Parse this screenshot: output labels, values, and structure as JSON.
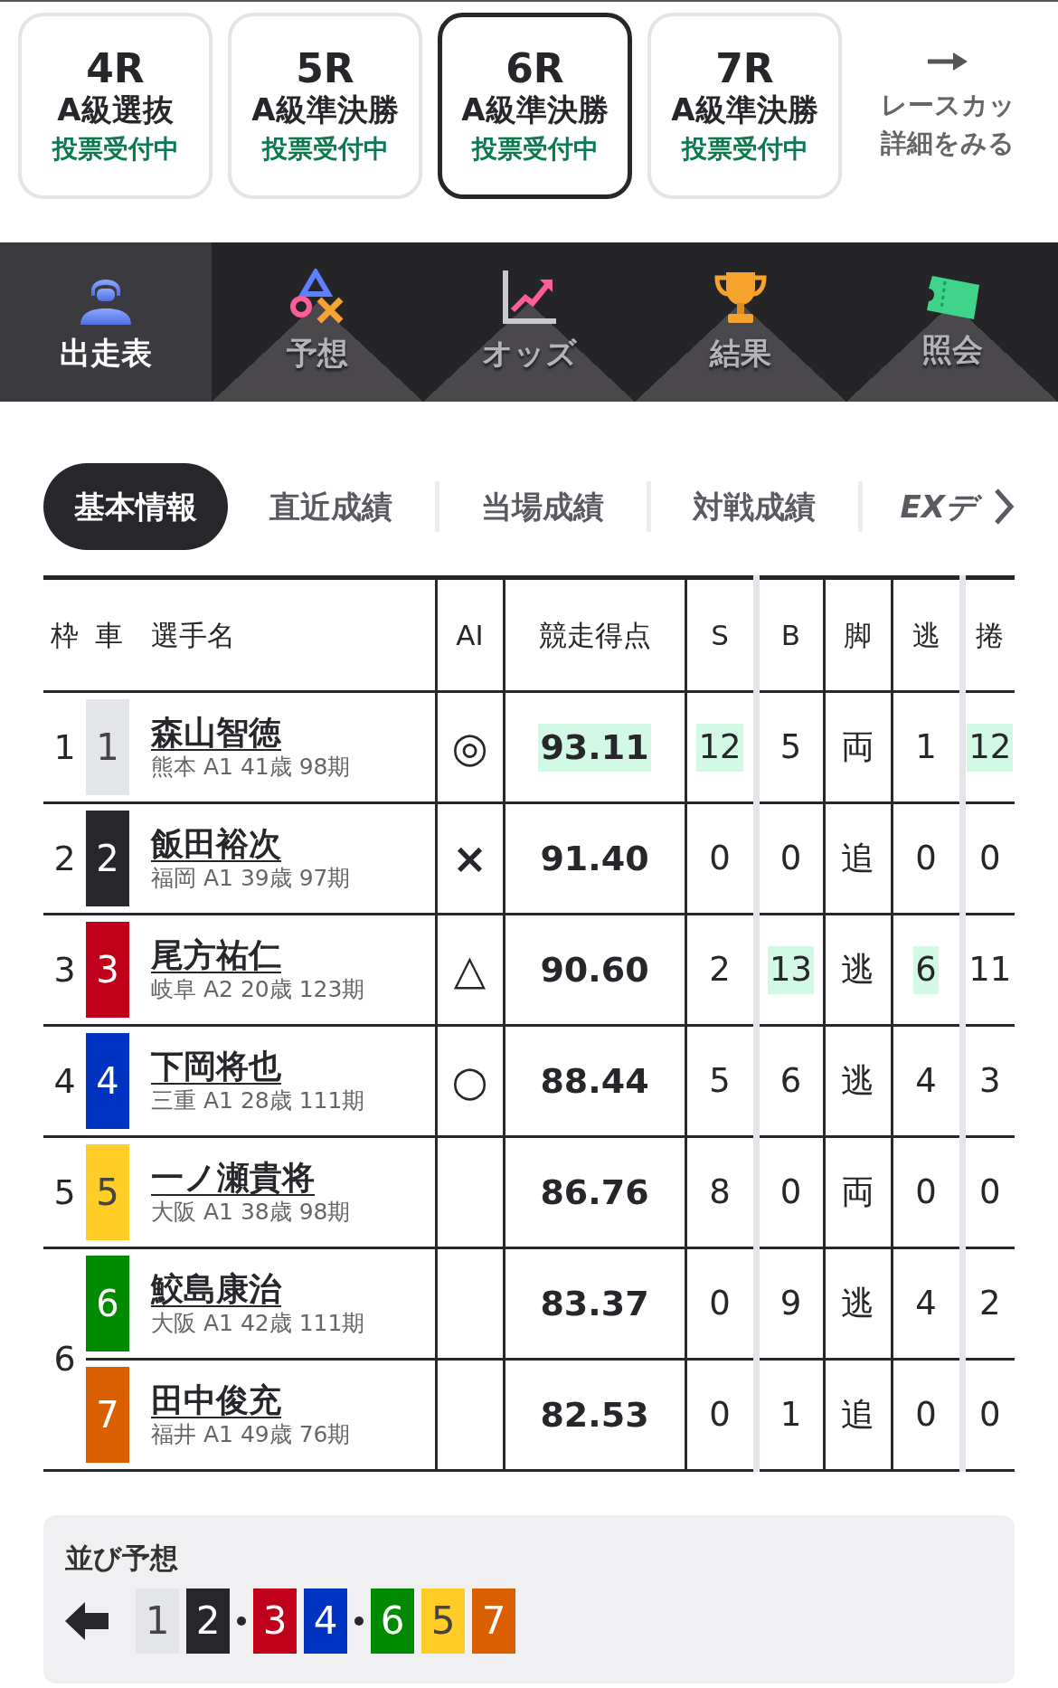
{
  "race_tabs": [
    {
      "race": "4R",
      "grade": "A級選抜",
      "status": "投票受付中",
      "selected": false
    },
    {
      "race": "5R",
      "grade": "A級準決勝",
      "status": "投票受付中",
      "selected": false
    },
    {
      "race": "6R",
      "grade": "A級準決勝",
      "status": "投票受付中",
      "selected": true
    },
    {
      "race": "7R",
      "grade": "A級準決勝",
      "status": "投票受付中",
      "selected": false
    }
  ],
  "cup_link": {
    "line1": "レースカッ",
    "line2": "詳細をみる"
  },
  "main_tabs": [
    {
      "label": "出走表",
      "kind": "rider",
      "selected": true
    },
    {
      "label": "予想",
      "kind": "symbols",
      "selected": false
    },
    {
      "label": "オッズ",
      "kind": "chart",
      "selected": false
    },
    {
      "label": "結果",
      "kind": "trophy",
      "selected": false
    },
    {
      "label": "照会",
      "kind": "ticket",
      "selected": false
    }
  ],
  "sub_tabs": [
    {
      "label": "基本情報",
      "selected": true
    },
    {
      "label": "直近成績",
      "selected": false
    },
    {
      "label": "当場成績",
      "selected": false
    },
    {
      "label": "対戦成績",
      "selected": false
    },
    {
      "label": "EXデ",
      "selected": false
    }
  ],
  "table": {
    "columns": [
      "枠",
      "車",
      "選手名",
      "AI",
      "競走得点",
      "S",
      "B",
      "脚",
      "逃",
      "捲"
    ],
    "frames": [
      {
        "frame": "1",
        "riders": [
          {
            "car": "1",
            "color": "#e4e5e9",
            "name": "森山智徳",
            "profile": "熊本 A1 41歳 98期",
            "ai_mark": "◎",
            "score": {
              "text": "93.11",
              "highlighted": true
            },
            "stats": [
              {
                "text": "12",
                "highlighted": true
              },
              {
                "text": "5",
                "highlighted": false
              },
              {
                "text": "両",
                "highlighted": false
              },
              {
                "text": "1",
                "highlighted": false
              },
              {
                "text": "12",
                "highlighted": true
              }
            ]
          }
        ]
      },
      {
        "frame": "2",
        "riders": [
          {
            "car": "2",
            "color": "#27272b",
            "name": "飯田裕次",
            "profile": "福岡 A1 39歳 97期",
            "ai_mark": "×",
            "score": {
              "text": "91.40",
              "highlighted": false
            },
            "stats": [
              {
                "text": "0",
                "highlighted": false
              },
              {
                "text": "0",
                "highlighted": false
              },
              {
                "text": "追",
                "highlighted": false
              },
              {
                "text": "0",
                "highlighted": false
              },
              {
                "text": "0",
                "highlighted": false
              }
            ]
          }
        ]
      },
      {
        "frame": "3",
        "riders": [
          {
            "car": "3",
            "color": "#c0001a",
            "name": "尾方祐仁",
            "profile": "岐阜 A2 20歳 123期",
            "ai_mark": "△",
            "score": {
              "text": "90.60",
              "highlighted": false
            },
            "stats": [
              {
                "text": "2",
                "highlighted": false
              },
              {
                "text": "13",
                "highlighted": true
              },
              {
                "text": "逃",
                "highlighted": false
              },
              {
                "text": "6",
                "highlighted": true
              },
              {
                "text": "11",
                "highlighted": false
              }
            ]
          }
        ]
      },
      {
        "frame": "4",
        "riders": [
          {
            "car": "4",
            "color": "#0033c0",
            "name": "下岡将也",
            "profile": "三重 A1 28歳 111期",
            "ai_mark": "○",
            "score": {
              "text": "88.44",
              "highlighted": false
            },
            "stats": [
              {
                "text": "5",
                "highlighted": false
              },
              {
                "text": "6",
                "highlighted": false
              },
              {
                "text": "逃",
                "highlighted": false
              },
              {
                "text": "4",
                "highlighted": false
              },
              {
                "text": "3",
                "highlighted": false
              }
            ]
          }
        ]
      },
      {
        "frame": "5",
        "riders": [
          {
            "car": "5",
            "color": "#ffcd26",
            "name": "一ノ瀬貴将",
            "profile": "大阪 A1 38歳 98期",
            "score": {
              "text": "86.76",
              "highlighted": false
            },
            "stats": [
              {
                "text": "8",
                "highlighted": false
              },
              {
                "text": "0",
                "highlighted": false
              },
              {
                "text": "両",
                "highlighted": false
              },
              {
                "text": "0",
                "highlighted": false
              },
              {
                "text": "0",
                "highlighted": false
              }
            ]
          }
        ]
      },
      {
        "frame": "6",
        "riders": [
          {
            "car": "6",
            "color": "#008a00",
            "name": "鮫島康治",
            "profile": "大阪 A1 42歳 111期",
            "score": {
              "text": "83.37",
              "highlighted": false
            },
            "stats": [
              {
                "text": "0",
                "highlighted": false
              },
              {
                "text": "9",
                "highlighted": false
              },
              {
                "text": "逃",
                "highlighted": false
              },
              {
                "text": "4",
                "highlighted": false
              },
              {
                "text": "2",
                "highlighted": false
              }
            ]
          },
          {
            "car": "7",
            "color": "#d95f00",
            "name": "田中俊充",
            "profile": "福井 A1 49歳 76期",
            "score": {
              "text": "82.53",
              "highlighted": false
            },
            "stats": [
              {
                "text": "0",
                "highlighted": false
              },
              {
                "text": "1",
                "highlighted": false
              },
              {
                "text": "追",
                "highlighted": false
              },
              {
                "text": "0",
                "highlighted": false
              },
              {
                "text": "0",
                "highlighted": false
              }
            ]
          }
        ]
      }
    ]
  },
  "line_prediction": {
    "title": "並び予想",
    "groups": [
      [
        {
          "car": "1",
          "color": "#e4e5e9"
        },
        {
          "car": "2",
          "color": "#27272b"
        }
      ],
      [
        {
          "car": "3",
          "color": "#c0001a"
        },
        {
          "car": "4",
          "color": "#0033c0"
        }
      ],
      [
        {
          "car": "6",
          "color": "#008a00"
        },
        {
          "car": "5",
          "color": "#ffcd26"
        },
        {
          "car": "7",
          "color": "#d95f00"
        }
      ]
    ]
  }
}
